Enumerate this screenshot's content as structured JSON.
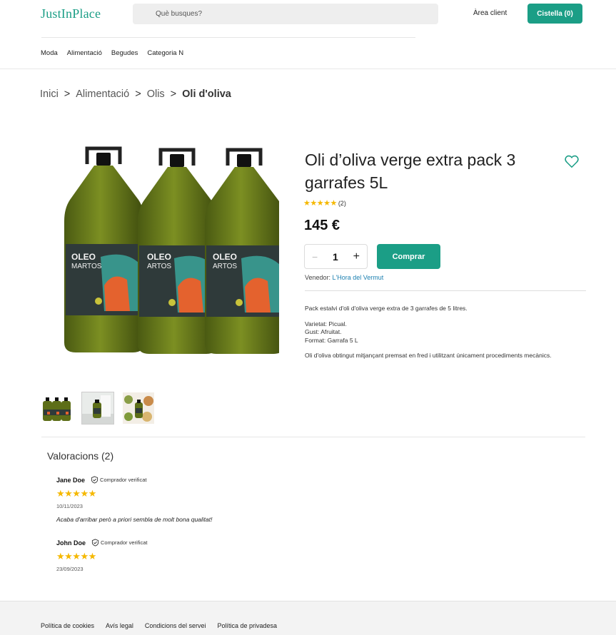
{
  "header": {
    "logo": "JustInPlace",
    "search_placeholder": "Què busques?",
    "area_client": "Àrea client",
    "cart": "Cistella (0)"
  },
  "nav": {
    "items": [
      "Moda",
      "Alimentació",
      "Begudes",
      "Categoria N"
    ]
  },
  "breadcrumb": {
    "items": [
      "Inici",
      "Alimentació",
      "Olis"
    ],
    "current": "Oli d'oliva",
    "separator": ">"
  },
  "product": {
    "title": "Oli d’oliva verge extra pack 3 garrafes 5L",
    "rating": 5,
    "stars": "★★★★★",
    "review_count": "(2)",
    "price": "145 €",
    "quantity": "1",
    "minus": "−",
    "plus": "+",
    "buy_label": "Comprar",
    "seller_label": "Venedor:",
    "seller_name": "L'Hora del Vermut",
    "description": [
      "Pack estalvi d'oli d'oliva verge extra de 3 garrafes de 5 litres.",
      "Varietat: Picual.",
      "Gust: Afruitat.",
      "Format: Garrafa 5 L",
      "Oli d'oliva obtingut mitjançant premsat en fred i utilitzant únicament procediments mecànics."
    ],
    "bottle_label": "OLEO MARTOS"
  },
  "reviews": {
    "title": "Valoracions (2)",
    "verified_label": "Comprador verificat",
    "items": [
      {
        "name": "Jane Doe",
        "stars": "★★★★★",
        "date": "10/11/2023",
        "text": "Acaba d'arribar però a priori sembla de molt bona qualitat!"
      },
      {
        "name": "John Doe",
        "stars": "★★★★★",
        "date": "23/09/2023",
        "text": ""
      }
    ]
  },
  "footer": {
    "links": [
      "Política de cookies",
      "Avís legal",
      "Condicions del servei",
      "Política de privadesa"
    ]
  },
  "colors": {
    "accent": "#1b9e86",
    "star": "#f5b800",
    "link": "#1b7fb0"
  },
  "icons": [
    "search-icon",
    "heart-icon",
    "verified-check-icon"
  ]
}
